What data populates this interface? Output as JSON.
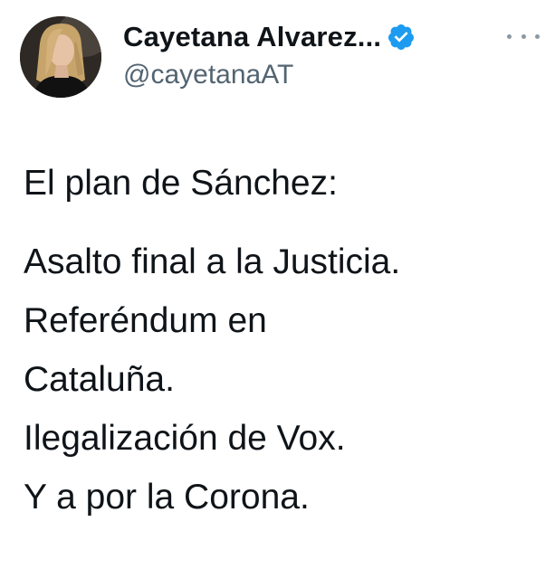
{
  "tweet": {
    "author": {
      "display_name": "Cayetana Alvarez...",
      "handle": "@cayetanaAT",
      "verified_icon": "verified-badge-icon",
      "verified_color": "#1d9bf0"
    },
    "more_icon": "more-horizontal-icon",
    "text": {
      "line1": "El plan de Sánchez:",
      "line2": "Asalto final a la Justicia.",
      "line3": "Referéndum en",
      "line4": "Cataluña.",
      "line5": "Ilegalización de Vox.",
      "line6": "Y a por la Corona."
    }
  }
}
